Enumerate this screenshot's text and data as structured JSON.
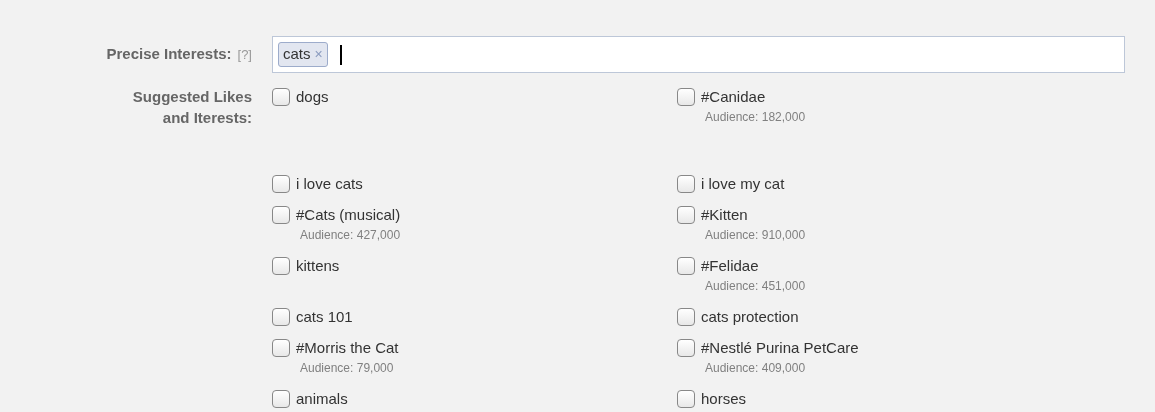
{
  "precise_interests": {
    "label": "Precise Interests:",
    "help": "[?]",
    "tokens": [
      {
        "text": "cats",
        "remove": "×"
      }
    ]
  },
  "suggested": {
    "label": "Suggested Likes and Iterests:",
    "items": [
      {
        "name": "dogs",
        "checked": false
      },
      {
        "name": "#Canidae",
        "audience": "Audience: 182,000",
        "checked": false
      },
      {
        "name": "i love cats",
        "checked": false
      },
      {
        "name": "i love my cat",
        "checked": false
      },
      {
        "name": "#Cats (musical)",
        "audience": "Audience: 427,000",
        "checked": false
      },
      {
        "name": "#Kitten",
        "audience": "Audience: 910,000",
        "checked": false
      },
      {
        "name": "kittens",
        "checked": false
      },
      {
        "name": "#Felidae",
        "audience": "Audience: 451,000",
        "checked": false
      },
      {
        "name": "cats 101",
        "checked": false
      },
      {
        "name": "cats protection",
        "checked": false
      },
      {
        "name": "#Morris the Cat",
        "audience": "Audience: 79,000",
        "checked": false
      },
      {
        "name": "#Nestlé Purina PetCare",
        "audience": "Audience: 409,000",
        "checked": false
      },
      {
        "name": "animals",
        "checked": false
      },
      {
        "name": "horses",
        "checked": false
      }
    ]
  }
}
